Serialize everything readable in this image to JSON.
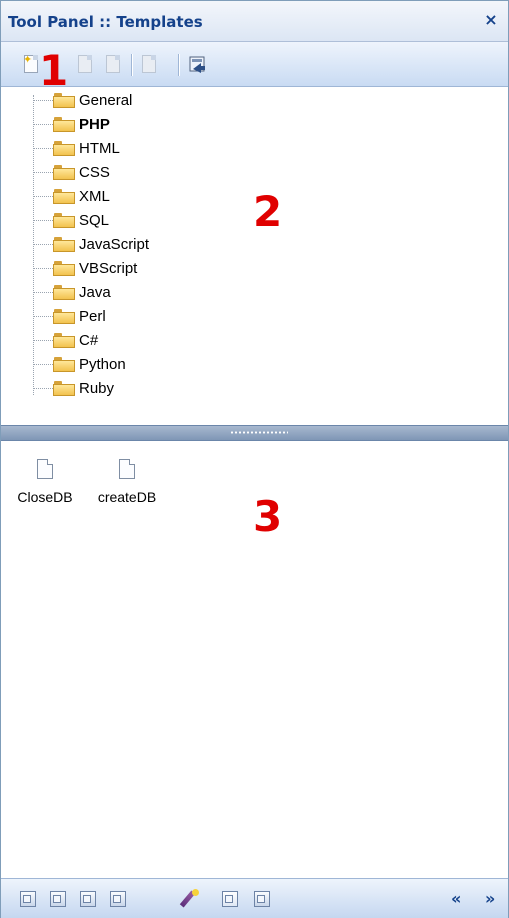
{
  "panel": {
    "title": "Tool Panel :: Templates",
    "close_glyph": "×"
  },
  "annotations": {
    "one": "1",
    "two": "2",
    "three": "3"
  },
  "toolbar": {
    "buttons": [
      {
        "name": "new-template-icon",
        "enabled": true
      },
      {
        "name": "copy-template-icon",
        "enabled": false
      },
      {
        "name": "paste-template-icon",
        "enabled": false
      },
      {
        "name": "delete-template-icon",
        "enabled": false
      },
      {
        "name": "export-template-icon",
        "enabled": true
      }
    ]
  },
  "tree": {
    "items": [
      {
        "label": "General",
        "bold": false
      },
      {
        "label": "PHP",
        "bold": true
      },
      {
        "label": "HTML",
        "bold": false
      },
      {
        "label": "CSS",
        "bold": false
      },
      {
        "label": "XML",
        "bold": false
      },
      {
        "label": "SQL",
        "bold": false
      },
      {
        "label": "JavaScript",
        "bold": false
      },
      {
        "label": "VBScript",
        "bold": false
      },
      {
        "label": "Java",
        "bold": false
      },
      {
        "label": "Perl",
        "bold": false
      },
      {
        "label": "C#",
        "bold": false
      },
      {
        "label": "Python",
        "bold": false
      },
      {
        "label": "Ruby",
        "bold": false
      }
    ]
  },
  "templates": {
    "items": [
      {
        "label": "CloseDB"
      },
      {
        "label": "createDB"
      }
    ]
  },
  "bottombar": {
    "nav_prev": "«",
    "nav_next": "»",
    "buttons": [
      "panel-1-icon",
      "panel-2-icon",
      "panel-3-icon",
      "panel-4-icon",
      "wizard-icon",
      "templates-panel-icon",
      "panel-7-icon"
    ]
  },
  "colors": {
    "accent": "#15428b",
    "annotation": "#e00000"
  }
}
